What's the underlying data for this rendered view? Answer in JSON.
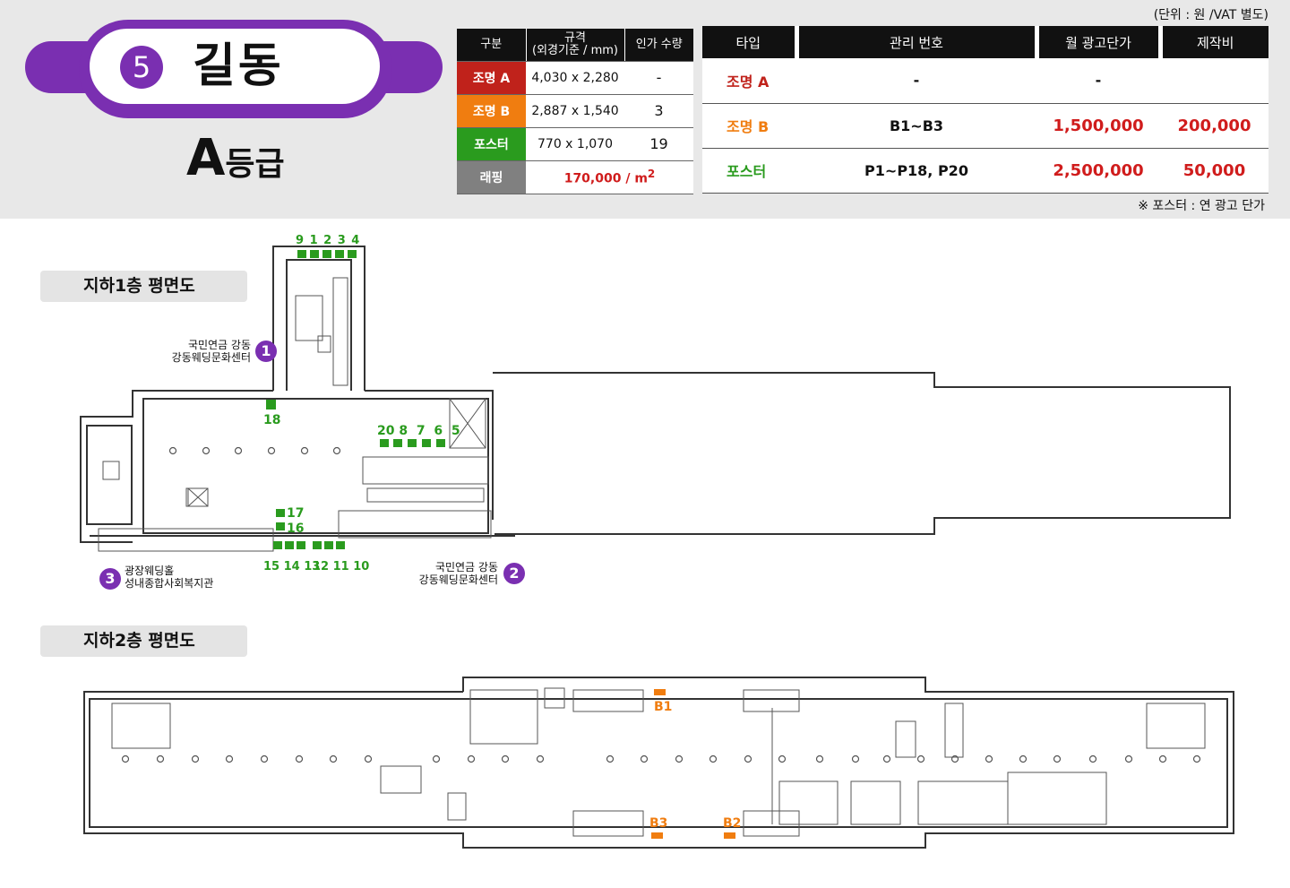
{
  "station": {
    "number": "5",
    "name": "길동",
    "grade_letter": "A",
    "grade_suffix": "등급"
  },
  "unit_note": "(단위 : 원 /VAT 별도)",
  "poster_note": "※ 포스터 : 연 광고 단가",
  "spec_table": {
    "headers": {
      "col1": "구분",
      "col2_line1": "규격",
      "col2_line2": "(외경기준 / mm)",
      "col3": "인가 수량"
    },
    "rows": [
      {
        "type": "조명 A",
        "size": "4,030 x 2,280",
        "qty": "-"
      },
      {
        "type": "조명 B",
        "size": "2,887 x 1,540",
        "qty": "3"
      },
      {
        "type": "포스터",
        "size": "770 x 1,070",
        "qty": "19"
      }
    ],
    "wrapping": {
      "type": "래핑",
      "price": "170,000 / m",
      "sup": "2"
    }
  },
  "price_table": {
    "headers": [
      "타입",
      "관리 번호",
      "월 광고단가",
      "제작비"
    ],
    "rows": [
      {
        "type": "조명 A",
        "id": "-",
        "price": "-",
        "cost": ""
      },
      {
        "type": "조명 B",
        "id": "B1~B3",
        "price": "1,500,000",
        "cost": "200,000"
      },
      {
        "type": "포스터",
        "id": "P1~P18, P20",
        "price": "2,500,000",
        "cost": "50,000"
      }
    ]
  },
  "floor1": {
    "label": "지하1층 평면도",
    "exit1": {
      "num": "1",
      "line1": "국민연금 강동",
      "line2": "강동웨딩문화센터"
    },
    "exit2": {
      "num": "2",
      "line1": "국민연금 강동",
      "line2": "강동웨딩문화센터"
    },
    "exit3": {
      "num": "3",
      "line1": "광장웨딩홀",
      "line2": "성내종합사회복지관"
    },
    "numbers": {
      "top": "9 1 2 3 4",
      "n18": "18",
      "mid": "20 8  7  6  5",
      "n17": "17",
      "n16": "16",
      "bottom_left": "15 14 13",
      "bottom_right": "12 11 10"
    }
  },
  "floor2": {
    "label": "지하2층 평면도",
    "b1": "B1",
    "b2": "B2",
    "b3": "B3"
  },
  "colors": {
    "purple": "#7a2fb1",
    "green": "#2a9b1e",
    "orange": "#f07d10",
    "red": "#d01c1c"
  }
}
